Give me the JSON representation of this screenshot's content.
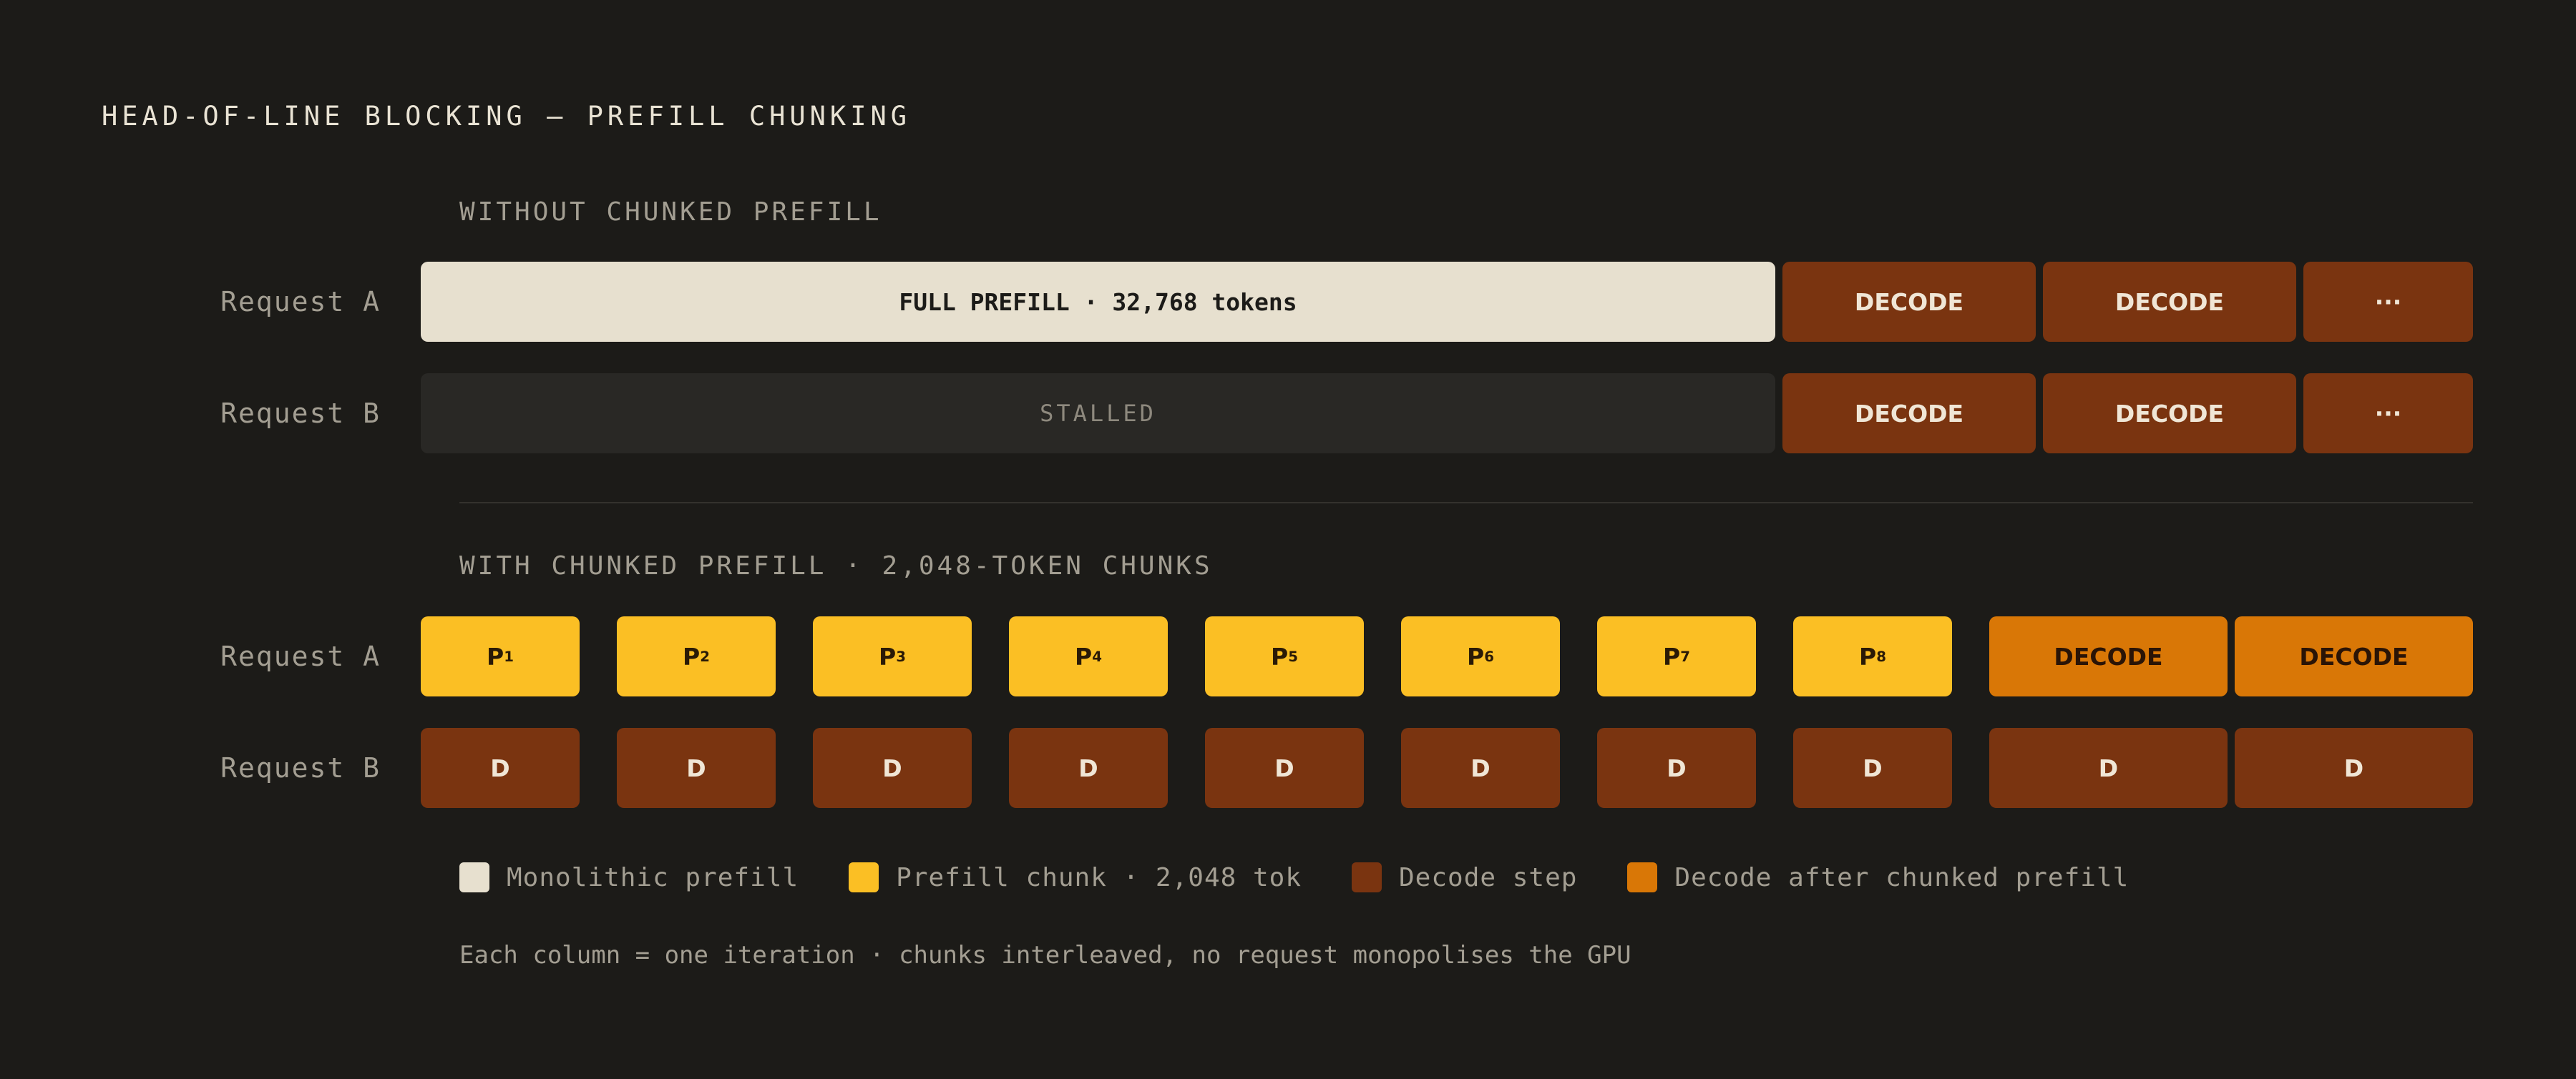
{
  "title": "HEAD-OF-LINE BLOCKING — PREFILL CHUNKING",
  "colors": {
    "monolithic_prefill": "#e7e0cf",
    "prefill_chunk": "#fbbf24",
    "decode_step": "#7a3410",
    "decode_after_chunked": "#d97706",
    "stalled": "#292825"
  },
  "without": {
    "section_label": "WITHOUT CHUNKED PREFILL",
    "request_a": {
      "label": "Request A",
      "prefill": "FULL PREFILL · 32,768 tokens",
      "decode1": "DECODE",
      "decode2": "DECODE",
      "more": "···"
    },
    "request_b": {
      "label": "Request B",
      "stalled": "STALLED",
      "decode1": "DECODE",
      "decode2": "DECODE",
      "more": "···"
    }
  },
  "with": {
    "section_label": "WITH CHUNKED PREFILL · 2,048-TOKEN CHUNKS",
    "request_a": {
      "label": "Request A",
      "chunk_prefix": "P",
      "chunks": [
        "1",
        "2",
        "3",
        "4",
        "5",
        "6",
        "7",
        "8"
      ],
      "decode1": "DECODE",
      "decode2": "DECODE"
    },
    "request_b": {
      "label": "Request B",
      "decode_steps": [
        "D",
        "D",
        "D",
        "D",
        "D",
        "D",
        "D",
        "D",
        "D",
        "D"
      ]
    }
  },
  "legend": [
    {
      "label": "Monolithic prefill"
    },
    {
      "label": "Prefill chunk · 2,048 tok"
    },
    {
      "label": "Decode step"
    },
    {
      "label": "Decode after chunked prefill"
    }
  ],
  "footnote": "Each column = one iteration · chunks interleaved, no request monopolises the GPU"
}
